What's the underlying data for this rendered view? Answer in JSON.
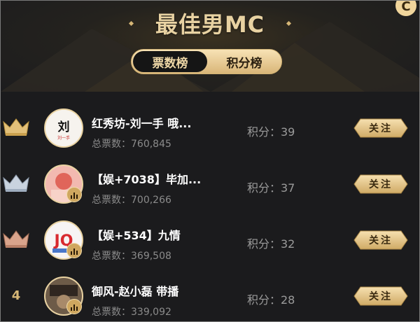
{
  "header": {
    "title": "最佳男MC",
    "tabs": [
      {
        "label": "票数榜",
        "active": true
      },
      {
        "label": "积分榜",
        "active": false
      }
    ]
  },
  "entries": [
    {
      "rank": "1",
      "rank_icon": "gold-crown-icon",
      "name": "红秀坊-刘一手 哦...",
      "votes": "总票数：760,845",
      "score": "积分：39",
      "follow": "关注",
      "avatar_text": "刘一手"
    },
    {
      "rank": "2",
      "rank_icon": "silver-crown-icon",
      "name": "【娱+7038】毕加...",
      "votes": "总票数：700,266",
      "score": "积分：37",
      "follow": "关注"
    },
    {
      "rank": "3",
      "rank_icon": "bronze-crown-icon",
      "name": "【娱+534】九情",
      "votes": "总票数：369,508",
      "score": "积分：32",
      "follow": "关注"
    },
    {
      "rank": "4",
      "name": "御风-赵小磊 带播",
      "votes": "总票数：339,092",
      "score": "积分：28",
      "follow": "关注"
    }
  ],
  "colors": {
    "gold": "#d6b676",
    "background": "#1b1b1d"
  }
}
